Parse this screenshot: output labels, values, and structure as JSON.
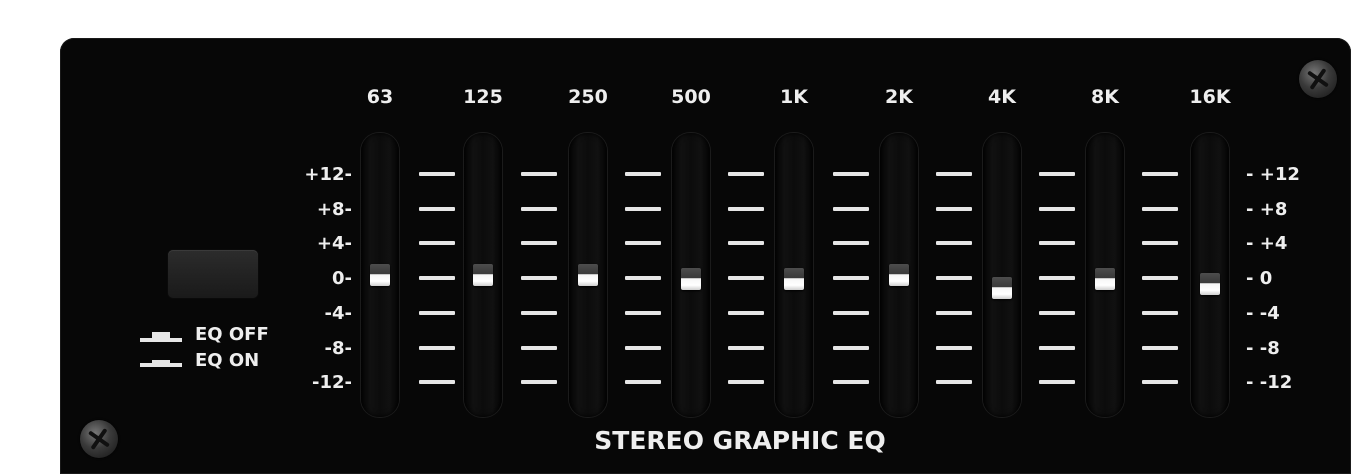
{
  "eq": {
    "title": "STEREO GRAPHIC EQ",
    "bands": [
      {
        "label": "63",
        "gain_db": 0
      },
      {
        "label": "125",
        "gain_db": 0
      },
      {
        "label": "250",
        "gain_db": 0
      },
      {
        "label": "500",
        "gain_db": -0.5
      },
      {
        "label": "1K",
        "gain_db": -0.5
      },
      {
        "label": "2K",
        "gain_db": 0
      },
      {
        "label": "4K",
        "gain_db": -1.5
      },
      {
        "label": "8K",
        "gain_db": -0.5
      },
      {
        "label": "16K",
        "gain_db": -1
      }
    ],
    "scale_left": [
      "+12-",
      "+8-",
      "+4-",
      "0-",
      "-4-",
      "-8-",
      "-12-"
    ],
    "scale_right": [
      "- +12",
      "- +8",
      "- +4",
      "- 0",
      "- -4",
      "- -8",
      "- -12"
    ],
    "switch": {
      "off_label": "EQ OFF",
      "on_label": "EQ ON"
    }
  },
  "colors": {
    "panel": "#070707",
    "text": "#eeeeee",
    "knob": "#f5f5f5"
  }
}
